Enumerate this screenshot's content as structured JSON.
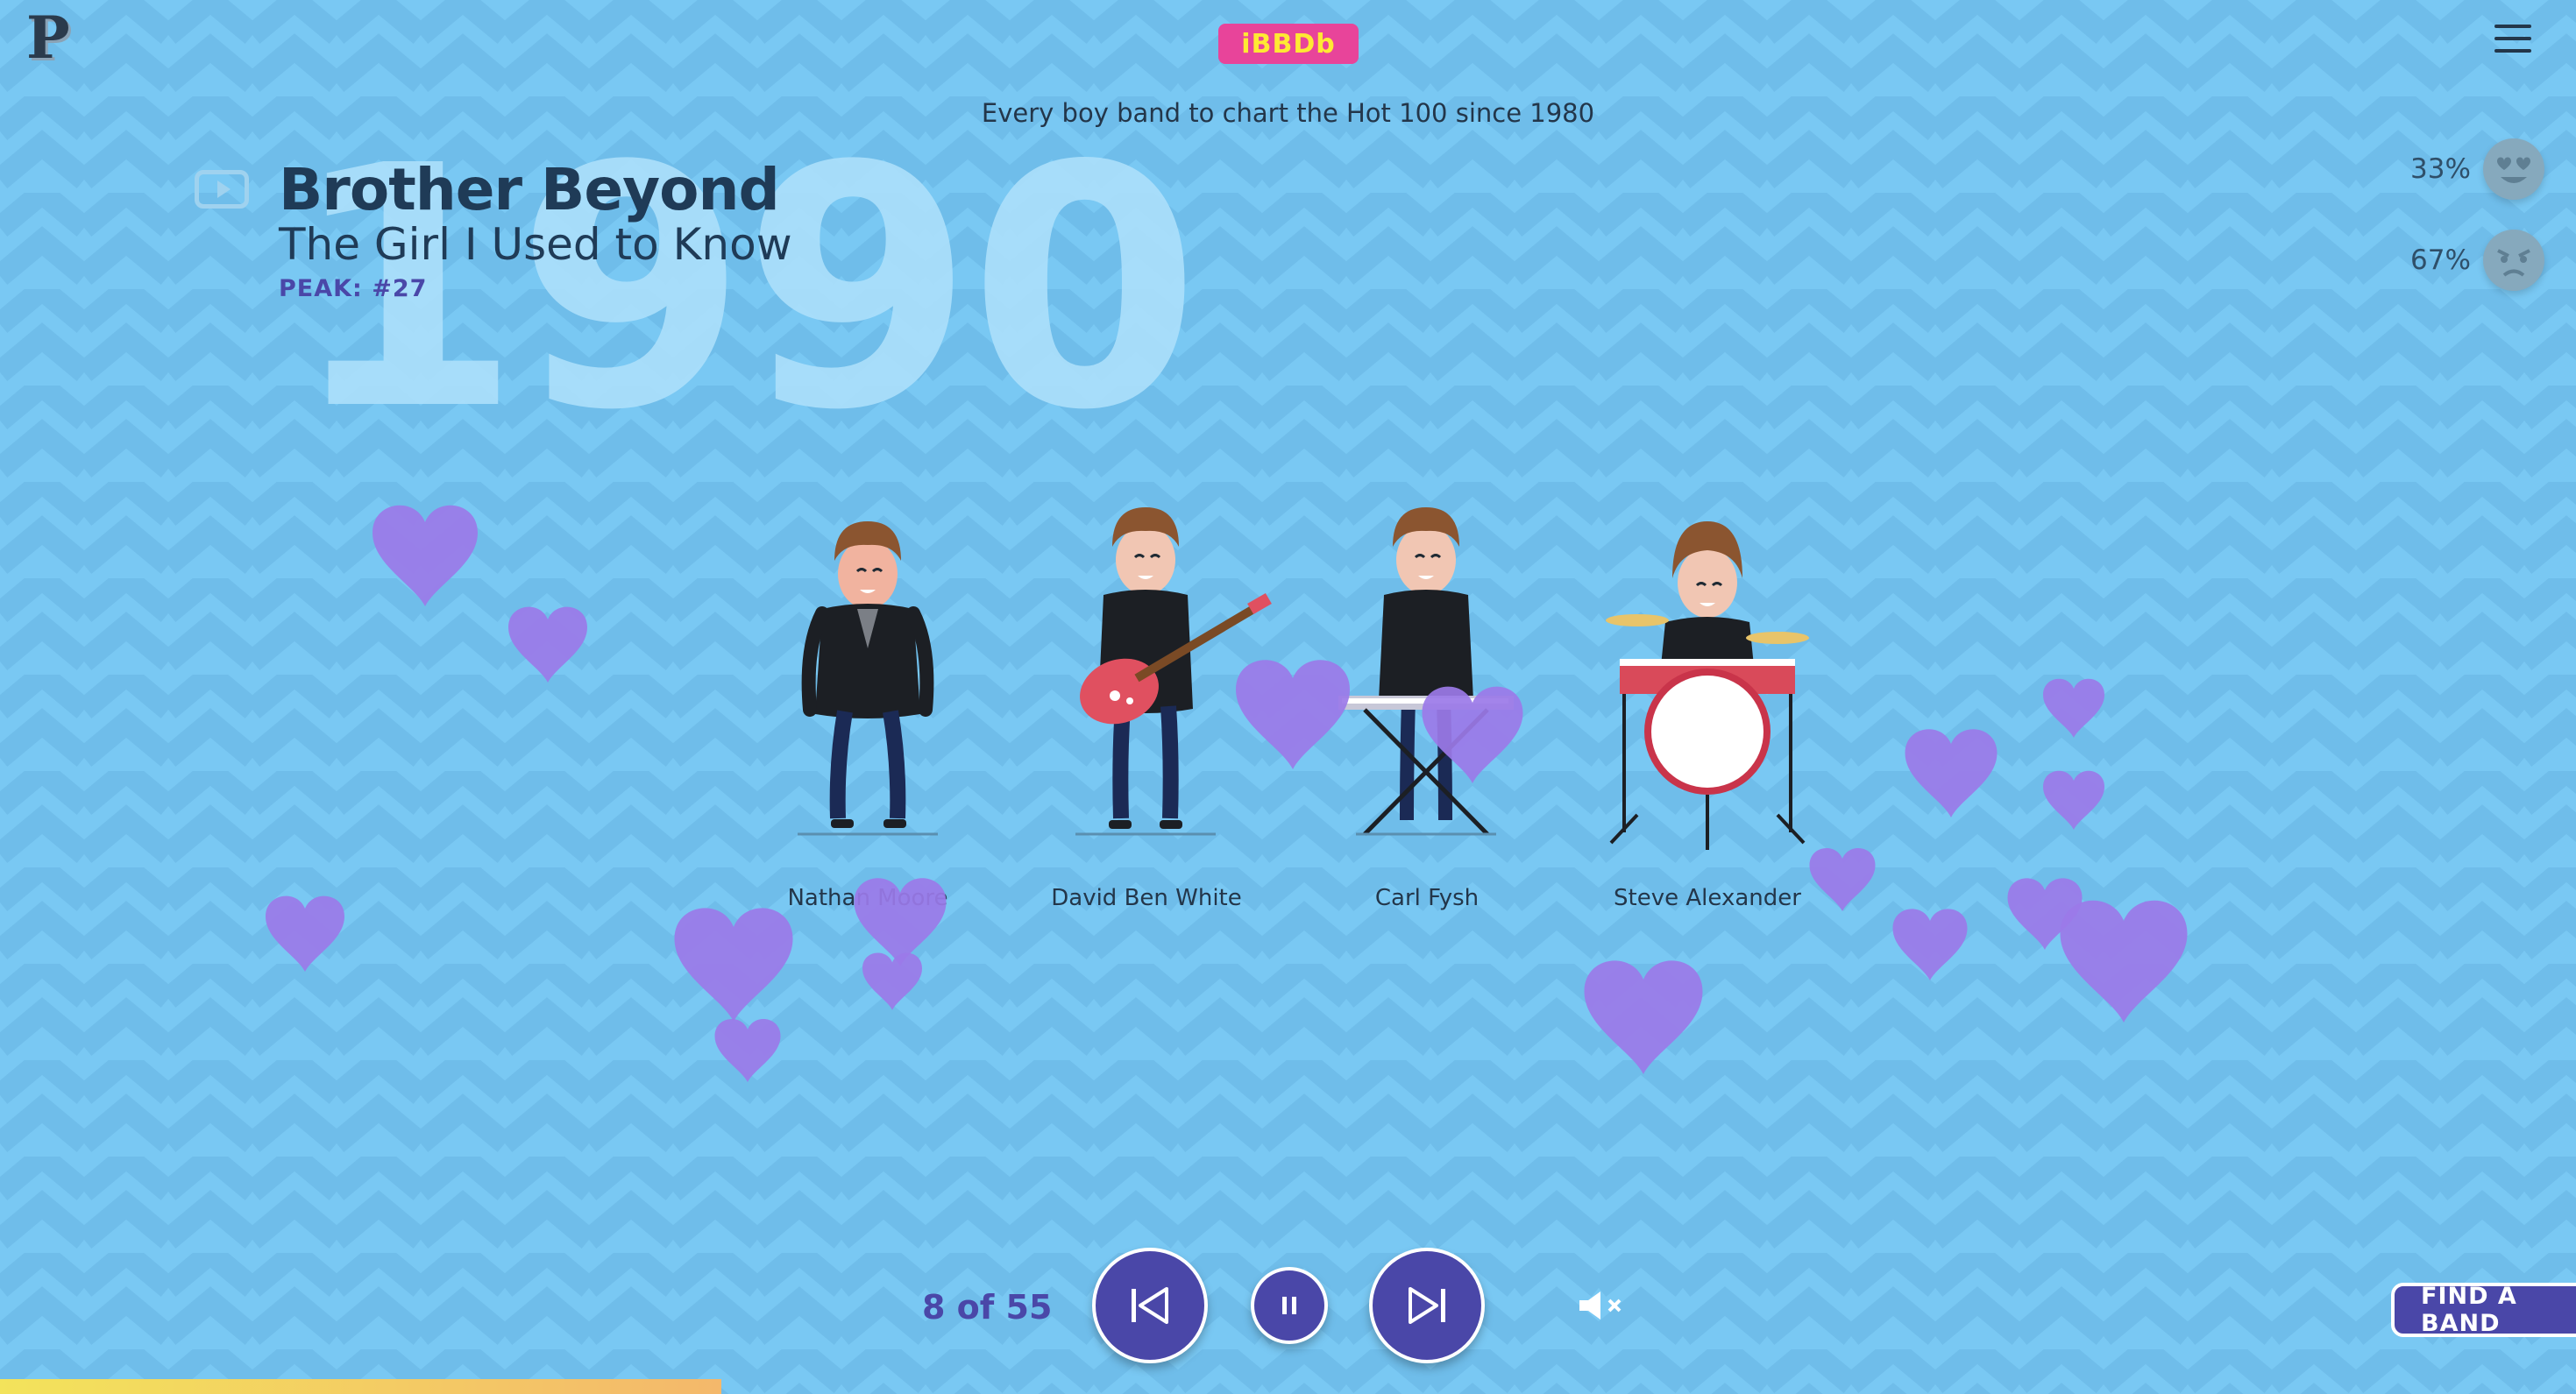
{
  "header": {
    "logo": "P",
    "badge": "iBBDb",
    "subtitle": "Every boy band to chart the Hot 100 since 1980"
  },
  "song": {
    "year": "1990",
    "band": "Brother Beyond",
    "title": "The Girl I Used to Know",
    "peak": "PEAK: #27"
  },
  "reactions": [
    {
      "pct": "33%",
      "icon": "heart-eyes-emoji-icon"
    },
    {
      "pct": "67%",
      "icon": "angry-face-emoji-icon"
    }
  ],
  "members": [
    {
      "name": "Nathan Moore",
      "role": "vocals"
    },
    {
      "name": "David Ben White",
      "role": "guitar"
    },
    {
      "name": "Carl Fysh",
      "role": "keyboard"
    },
    {
      "name": "Steve Alexander",
      "role": "drums"
    }
  ],
  "controls": {
    "counter": "8 of 55",
    "find_band": "FIND A BAND",
    "progress_fraction": 0.28
  },
  "colors": {
    "background": "#79c8f3",
    "accent": "#4a47a8",
    "badge": "#e8449a",
    "heart": "#9b7ae8"
  }
}
